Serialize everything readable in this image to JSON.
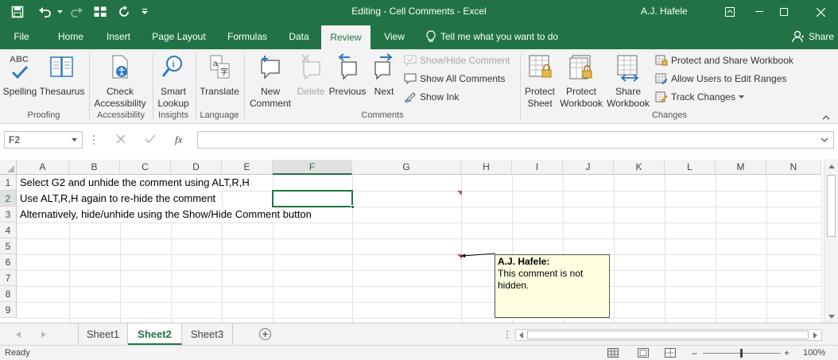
{
  "titlebar": {
    "title": "Editing - Cell Comments  -  Excel",
    "user": "A.J. Hafele"
  },
  "tabs": [
    "File",
    "Home",
    "Insert",
    "Page Layout",
    "Formulas",
    "Data",
    "Review",
    "View"
  ],
  "tell_me": "Tell me what you want to do",
  "share": "Share",
  "ribbon": {
    "proofing": {
      "spelling_abc": "ABC",
      "spelling": "Spelling",
      "thesaurus": "Thesaurus",
      "group": "Proofing"
    },
    "accessibility": {
      "check1": "Check",
      "check2": "Accessibility",
      "group": "Accessibility"
    },
    "insights": {
      "smart1": "Smart",
      "smart2": "Lookup",
      "group": "Insights"
    },
    "language": {
      "translate": "Translate",
      "group": "Language"
    },
    "comments": {
      "new1": "New",
      "new2": "Comment",
      "delete": "Delete",
      "previous": "Previous",
      "next": "Next",
      "show_hide": "Show/Hide Comment",
      "show_all": "Show All Comments",
      "show_ink": "Show Ink",
      "group": "Comments"
    },
    "changes": {
      "protect_sheet1": "Protect",
      "protect_sheet2": "Sheet",
      "protect_wb1": "Protect",
      "protect_wb2": "Workbook",
      "share_wb1": "Share",
      "share_wb2": "Workbook",
      "protect_share": "Protect and Share Workbook",
      "allow_users": "Allow Users to Edit Ranges",
      "track_changes": "Track Changes",
      "group": "Changes"
    }
  },
  "formula_bar": {
    "name_box": "F2",
    "fx": "fx",
    "value": ""
  },
  "columns": [
    "A",
    "B",
    "C",
    "D",
    "E",
    "F",
    "G",
    "H",
    "I",
    "J",
    "K",
    "L",
    "M",
    "N"
  ],
  "rows": [
    "1",
    "2",
    "3",
    "4",
    "5",
    "6",
    "7",
    "8",
    "9"
  ],
  "cells": {
    "A1": "Select G2 and unhide the comment using ALT,R,H",
    "A2": "Use ALT,R,H again to re-hide the comment",
    "A3": "Alternatively, hide/unhide using the Show/Hide Comment button"
  },
  "selected_cell": "F2",
  "comment": {
    "author": "A.J. Hafele:",
    "text": "This comment is not hidden."
  },
  "sheets": [
    "Sheet1",
    "Sheet2",
    "Sheet3"
  ],
  "active_sheet": "Sheet2",
  "status": {
    "ready": "Ready",
    "zoom": "100%",
    "zoom_minus": "–",
    "zoom_plus": "+"
  },
  "colors": {
    "brand_green": "#217346",
    "comment_bg": "#ffffe1",
    "comment_indicator": "#c0504d"
  }
}
